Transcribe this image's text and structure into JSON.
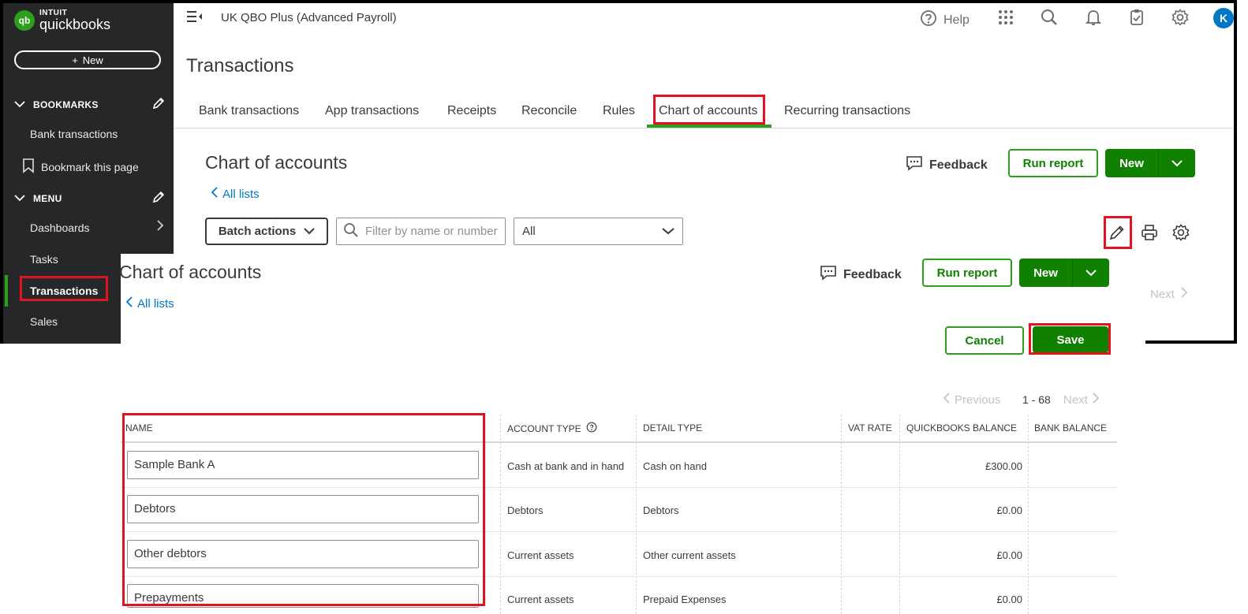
{
  "app": {
    "brand_top": "INTUIT",
    "brand_main": "quickbooks",
    "logo_mark": "qb",
    "company": "UK QBO Plus (Advanced Payroll)",
    "avatar_initial": "K",
    "help_label": "Help"
  },
  "sidebar": {
    "new_label": "New",
    "new_plus": "+",
    "bookmarks_title": "BOOKMARKS",
    "bookmark_items": [
      "Bank transactions",
      "Bookmark this page"
    ],
    "menu_title": "MENU",
    "menu_items": [
      "Dashboards",
      "Tasks",
      "Transactions",
      "Sales"
    ],
    "active_item": "Transactions"
  },
  "page": {
    "title": "Transactions",
    "tabs": [
      "Bank transactions",
      "App transactions",
      "Receipts",
      "Reconcile",
      "Rules",
      "Chart of accounts",
      "Recurring transactions"
    ],
    "active_tab": "Chart of accounts"
  },
  "coa": {
    "title": "Chart of accounts",
    "all_lists": "All lists",
    "feedback": "Feedback",
    "run_report": "Run report",
    "new": "New",
    "batch_actions": "Batch actions",
    "filter_placeholder": "Filter by name or number",
    "type_select": "All",
    "cancel": "Cancel",
    "save": "Save",
    "previous": "Previous",
    "next": "Next",
    "range": "1 - 68"
  },
  "table": {
    "columns": [
      "NAME",
      "ACCOUNT TYPE",
      "DETAIL TYPE",
      "VAT RATE",
      "QUICKBOOKS BALANCE",
      "BANK BALANCE"
    ],
    "rows": [
      {
        "name": "Sample Bank A",
        "account_type": "Cash at bank and in hand",
        "detail_type": "Cash on hand",
        "vat_rate": "",
        "qb_balance": "£300.00",
        "bank_balance": ""
      },
      {
        "name": "Debtors",
        "account_type": "Debtors",
        "detail_type": "Debtors",
        "vat_rate": "",
        "qb_balance": "£0.00",
        "bank_balance": ""
      },
      {
        "name": "Other debtors",
        "account_type": "Current assets",
        "detail_type": "Other current assets",
        "vat_rate": "",
        "qb_balance": "£0.00",
        "bank_balance": ""
      },
      {
        "name": "Prepayments",
        "account_type": "Current assets",
        "detail_type": "Prepaid Expenses",
        "vat_rate": "",
        "qb_balance": "£0.00",
        "bank_balance": ""
      }
    ]
  },
  "colors": {
    "brand_green": "#2ca01c",
    "button_green": "#108000",
    "link_blue": "#0077c5",
    "highlight_red": "#e0131f",
    "sidebar_bg": "#262729"
  }
}
